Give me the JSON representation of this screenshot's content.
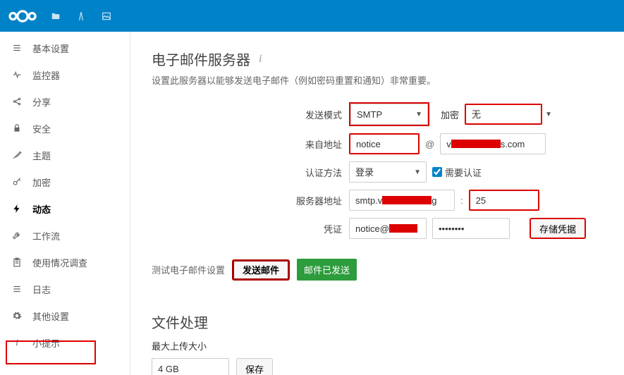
{
  "topbar": {},
  "sidebar": {
    "items": [
      {
        "label": "基本设置"
      },
      {
        "label": "监控器"
      },
      {
        "label": "分享"
      },
      {
        "label": "安全"
      },
      {
        "label": "主题"
      },
      {
        "label": "加密"
      },
      {
        "label": "动态"
      },
      {
        "label": "工作流"
      },
      {
        "label": "使用情况调查"
      },
      {
        "label": "日志"
      },
      {
        "label": "其他设置"
      },
      {
        "label": "小提示"
      }
    ]
  },
  "email": {
    "title": "电子邮件服务器",
    "desc": "设置此服务器以能够发送电子邮件（例如密码重置和通知）非常重要。",
    "labels": {
      "send_mode": "发送模式",
      "encryption": "加密",
      "from_address": "来自地址",
      "auth_method": "认证方法",
      "need_auth": "需要认证",
      "server_addr": "服务器地址",
      "credentials": "凭证",
      "store_creds": "存储凭据"
    },
    "values": {
      "send_mode": "SMTP",
      "encryption": "无",
      "from_user": "notice",
      "from_domain_prefix": "v",
      "from_domain_suffix": "s.com",
      "auth_method": "登录",
      "need_auth_checked": true,
      "server_host_prefix": "smtp.v",
      "server_host_suffix": "g",
      "server_port": "25",
      "cred_user_prefix": "notice@",
      "cred_pass": "********"
    },
    "test": {
      "label": "测试电子邮件设置",
      "send_btn": "发送邮件",
      "sent_badge": "邮件已发送"
    }
  },
  "file": {
    "title": "文件处理",
    "max_upload_label": "最大上传大小",
    "max_upload_value": "4 GB",
    "save_btn": "保存"
  }
}
